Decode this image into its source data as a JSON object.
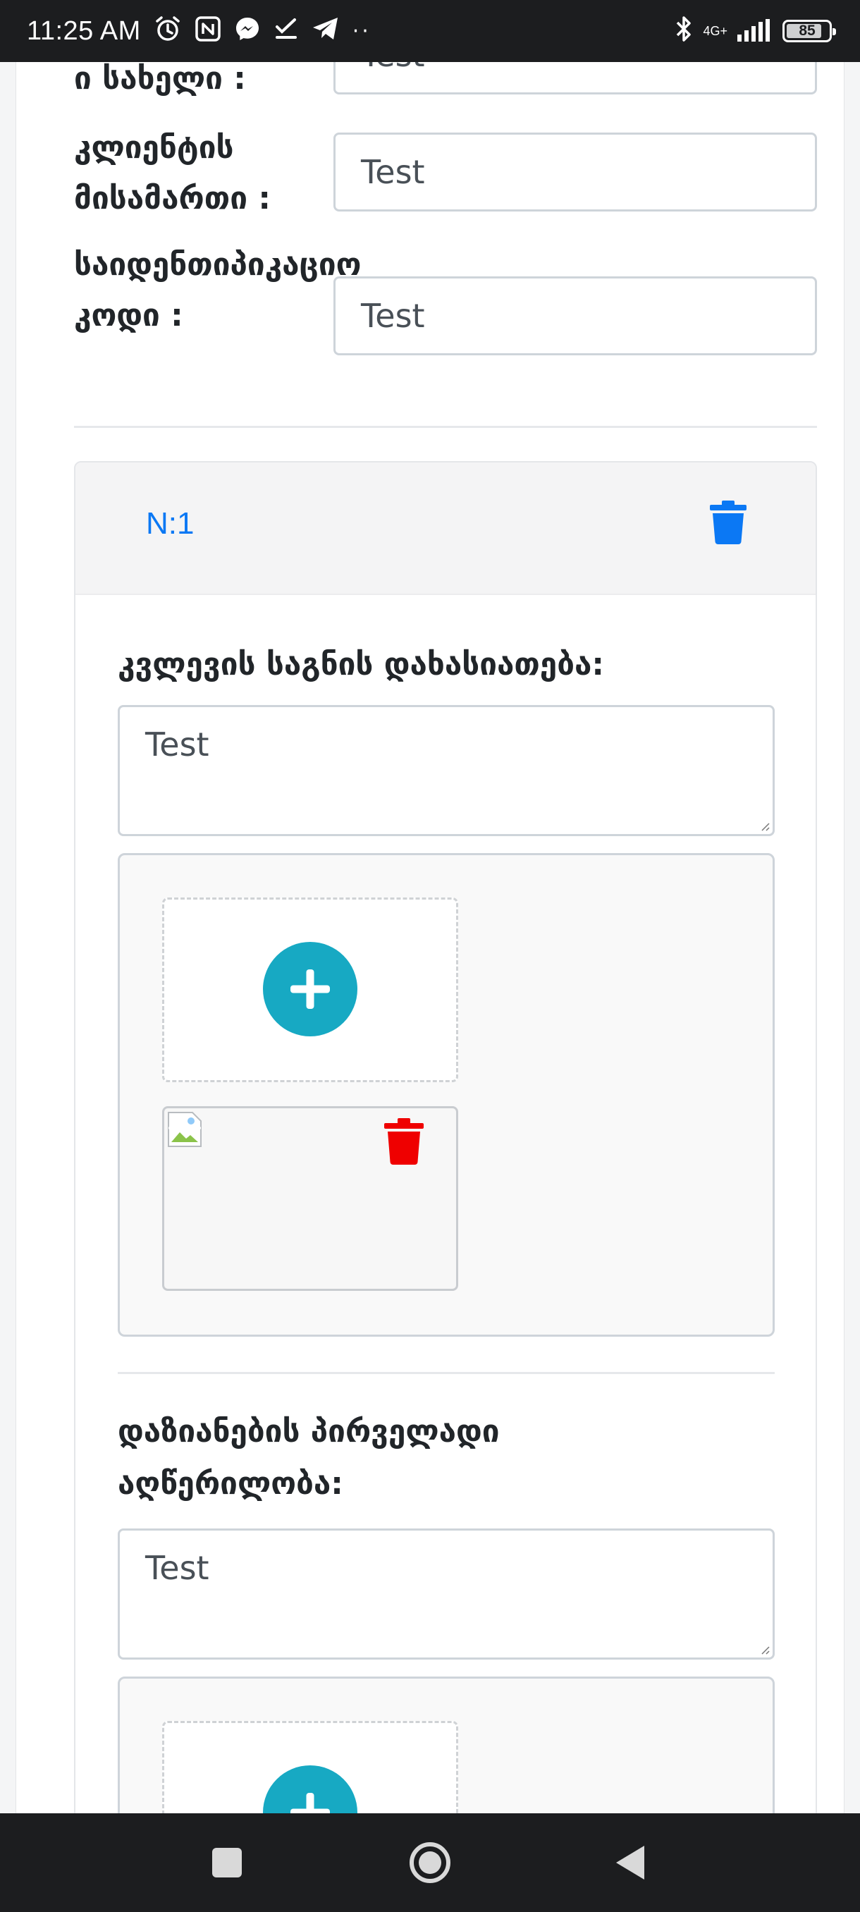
{
  "status_bar": {
    "time": "11:25 AM",
    "icons": [
      "alarm-icon",
      "nfc-icon",
      "messenger-icon",
      "task-check-icon",
      "telegram-icon",
      "more-dots-icon",
      "bluetooth-icon",
      "signal-icon",
      "battery-icon"
    ],
    "network_label": "4G+",
    "battery_level": "85",
    "battery_fraction": 0.85
  },
  "form": {
    "fields": [
      {
        "label": "ი სახელი :",
        "value": "Test"
      },
      {
        "label": "კლიენტის მისამართი :",
        "value": "Test"
      },
      {
        "label": "საიდენთიპიკაციო კოდი :",
        "value": "Test"
      }
    ]
  },
  "item": {
    "number": "N:1",
    "sections": [
      {
        "title": "კვლევის საგნის დახასიათება:",
        "value": "Test"
      },
      {
        "title": "დაზიანების პირველადი აღწერილობა:",
        "value": "Test"
      }
    ]
  },
  "colors": {
    "accent_blue": "#0b78f4",
    "add_button": "#17a9c3",
    "delete_red": "#ef0000",
    "bars": "#1c1d1f"
  },
  "nav_bar": {
    "buttons": [
      "recents-square-icon",
      "home-circle-icon",
      "back-triangle-icon"
    ]
  }
}
